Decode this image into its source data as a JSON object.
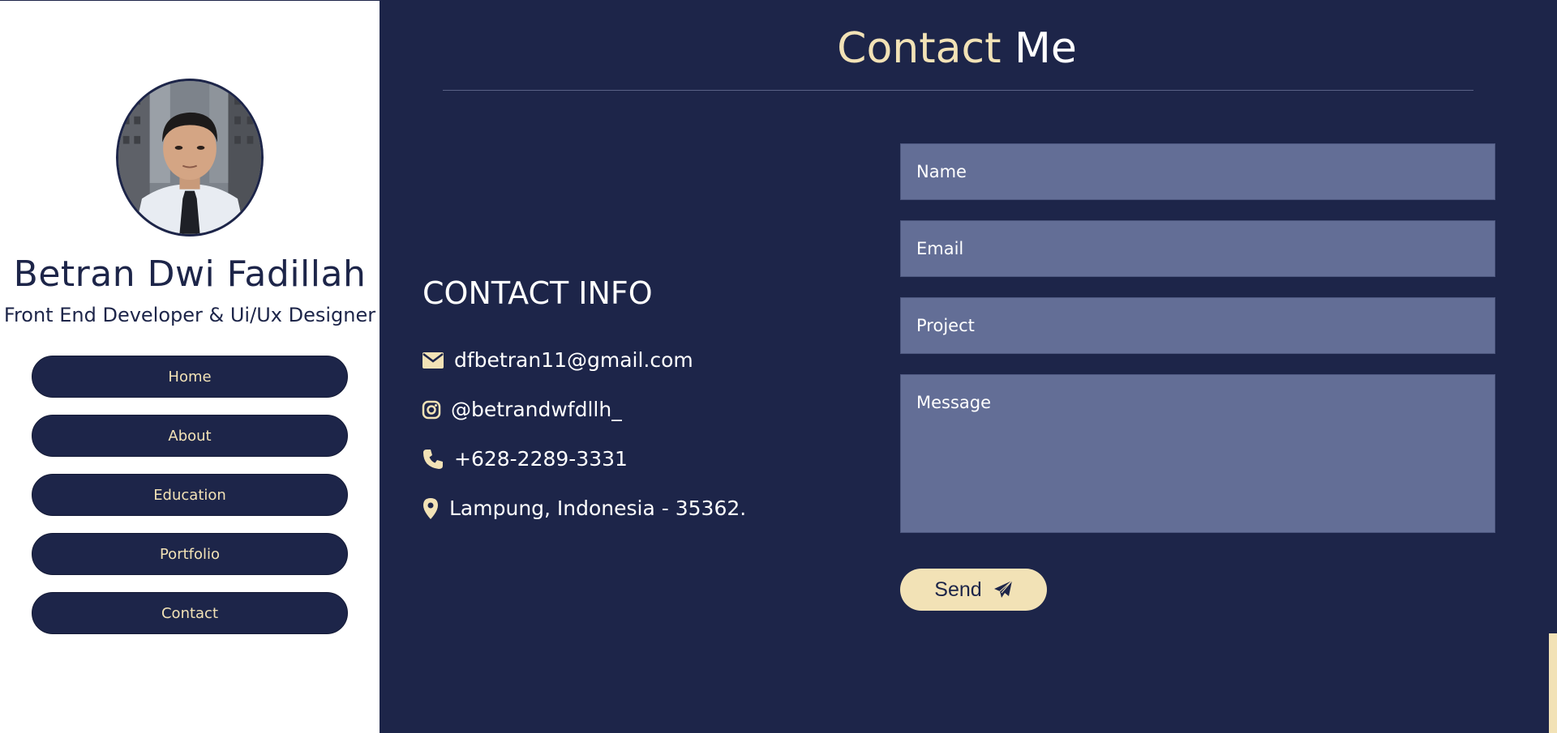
{
  "colors": {
    "navy": "#1d2549",
    "cream": "#f2e2b6",
    "field": "#636e96",
    "white": "#ffffff"
  },
  "profile": {
    "name": "Betran Dwi Fadillah",
    "role": "Front End Developer & Ui/Ux Designer"
  },
  "nav": {
    "items": [
      {
        "label": "Home"
      },
      {
        "label": "About"
      },
      {
        "label": "Education"
      },
      {
        "label": "Portfolio"
      },
      {
        "label": "Contact"
      }
    ]
  },
  "page": {
    "title_part1": "Contact",
    "title_part2": "Me"
  },
  "contact_info": {
    "heading": "CONTACT INFO",
    "email": {
      "icon": "envelope-icon",
      "text": "dfbetran11@gmail.com"
    },
    "instagram": {
      "icon": "instagram-icon",
      "text": "@betrandwfdllh_"
    },
    "phone": {
      "icon": "phone-icon",
      "text": "+628-2289-3331"
    },
    "location": {
      "icon": "map-pin-icon",
      "text": "Lampung, Indonesia - 35362."
    }
  },
  "form": {
    "name_placeholder": "Name",
    "email_placeholder": "Email",
    "project_placeholder": "Project",
    "message_placeholder": "Message",
    "send_label": "Send",
    "send_icon": "paper-plane-icon"
  }
}
